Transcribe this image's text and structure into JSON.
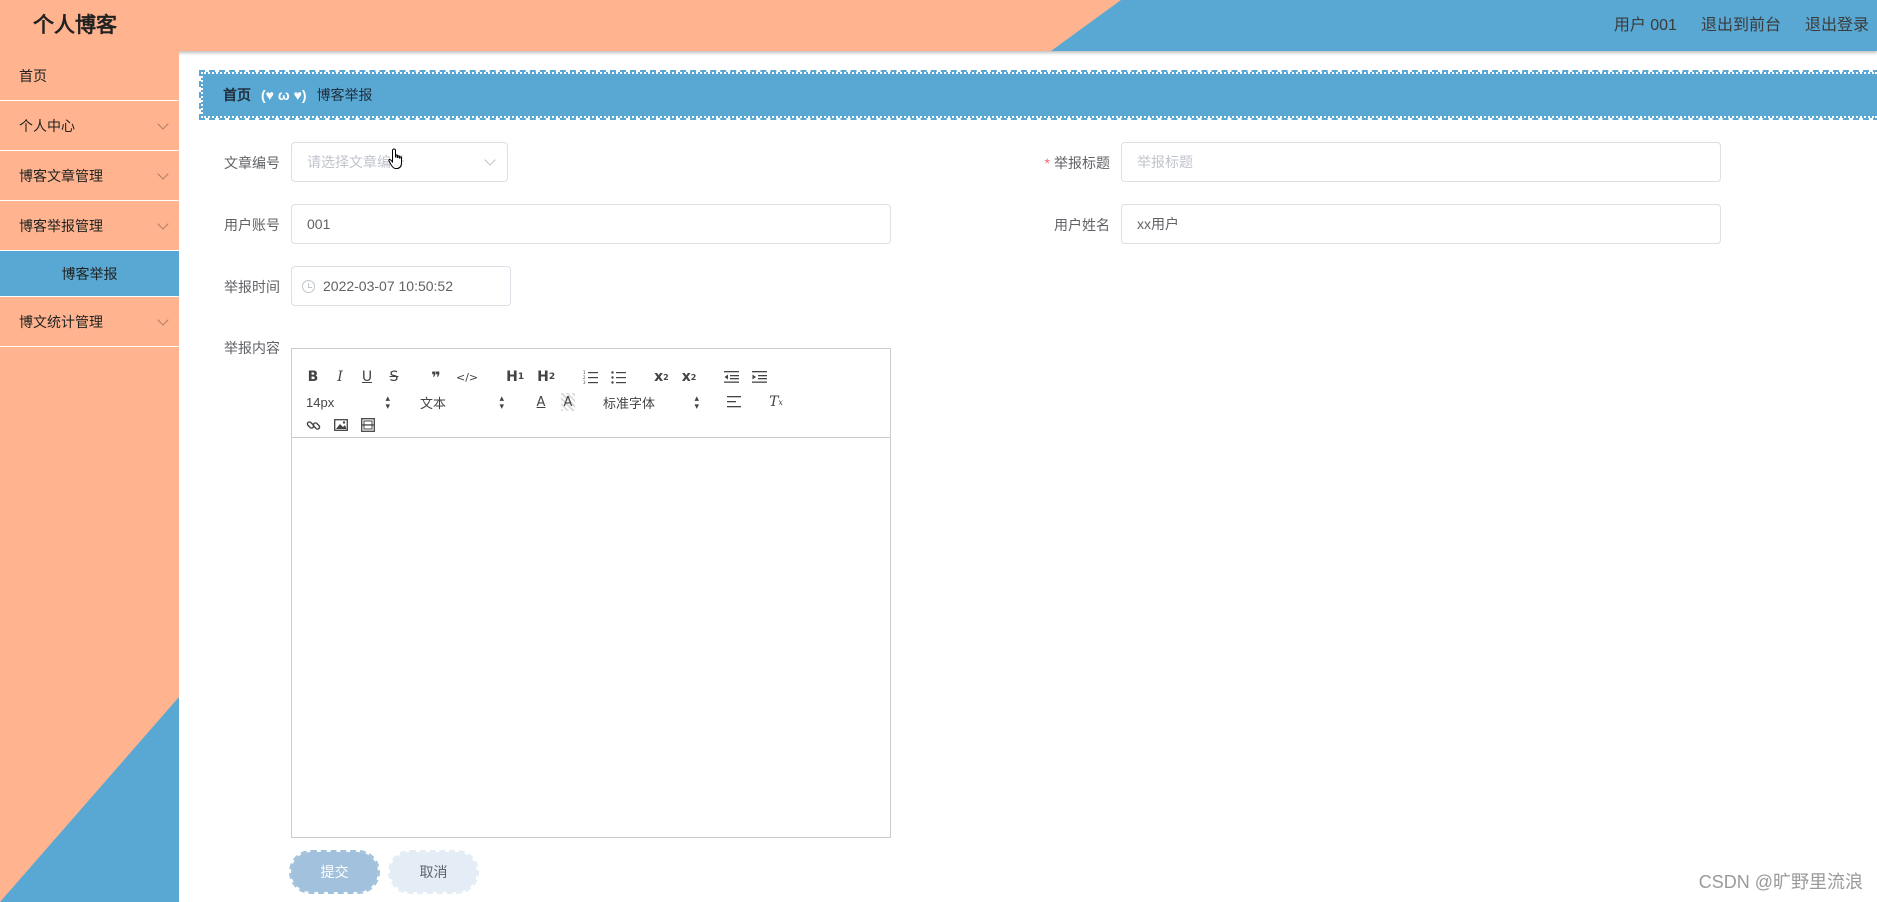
{
  "header": {
    "brand": "个人博客",
    "user": "用户 001",
    "exit_front": "退出到前台",
    "logout": "退出登录"
  },
  "sidebar": {
    "items": [
      {
        "label": "首页"
      },
      {
        "label": "个人中心"
      },
      {
        "label": "博客文章管理"
      },
      {
        "label": "博客举报管理"
      },
      {
        "label": "博客举报"
      },
      {
        "label": "博文统计管理"
      }
    ]
  },
  "breadcrumb": {
    "home": "首页",
    "separator": "(♥ ω ♥)",
    "current": "博客举报"
  },
  "form": {
    "article_no": {
      "label": "文章编号",
      "placeholder": "请选择文章编号"
    },
    "title": {
      "label": "举报标题",
      "required_mark": "*",
      "placeholder": "举报标题"
    },
    "account": {
      "label": "用户账号",
      "value": "001"
    },
    "username": {
      "label": "用户姓名",
      "value": "xx用户"
    },
    "time": {
      "label": "举报时间",
      "value": "2022-03-07 10:50:52"
    },
    "content": {
      "label": "举报内容"
    }
  },
  "editor": {
    "font_size": "14px",
    "header_select": "文本",
    "font_family": "标准字体"
  },
  "buttons": {
    "submit": "提交",
    "cancel": "取消"
  },
  "watermark": "CSDN @旷野里流浪",
  "colors": {
    "peach": "#ffb48f",
    "blue": "#58a8d3",
    "submit_bg": "#a2c1dd",
    "cancel_bg": "#e4edf6"
  }
}
